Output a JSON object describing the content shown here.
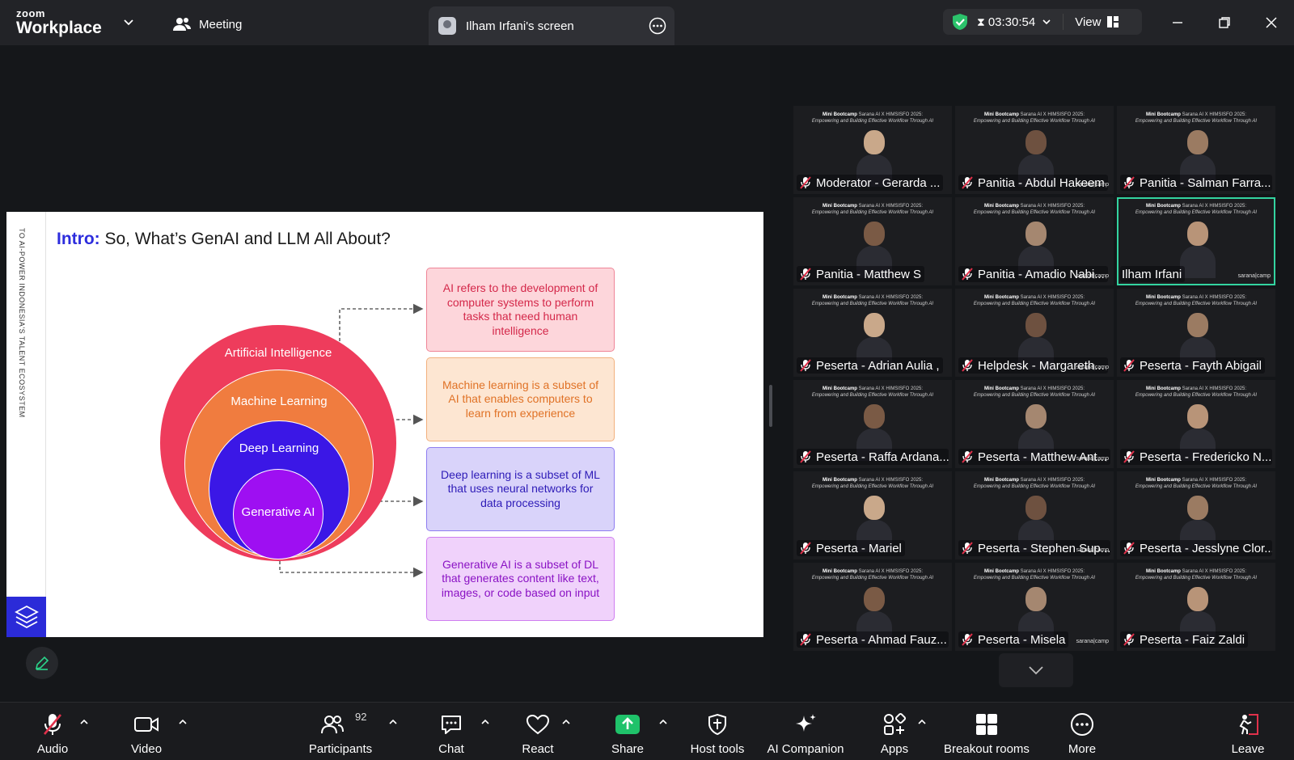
{
  "topbar": {
    "logo_zoom": "zoom",
    "logo_workplace": "Workplace",
    "meeting_label": "Meeting",
    "screen_tab_title": "Ilham Irfani's screen",
    "timer": "03:30:54",
    "view_label": "View"
  },
  "slide": {
    "side_text": "TO AI-POWER INDONESIA'S TALENT ECOSYSTEM",
    "title_prefix": "Intro:",
    "title_rest": "So, What’s GenAI and LLM All About?",
    "circles": {
      "ai": "Artificial Intelligence",
      "ml": "Machine Learning",
      "dl": "Deep Learning",
      "gen": "Generative AI"
    },
    "descriptions": {
      "ai": "AI refers to the development of computer systems to perform tasks that need human intelligence",
      "ml": "Machine learning is a subset of AI that enables computers to learn from experience",
      "dl": "Deep learning is a subset of ML that uses neural networks for data processing",
      "gen": "Generative AI is a subset of DL that generates content like text, images, or code based on input"
    },
    "colors": {
      "ai": "#ee3c5c",
      "ml": "#f07c3f",
      "dl": "#3b17e6",
      "gen": "#9e0ff2",
      "accent": "#2d2ddd"
    }
  },
  "gallery": {
    "tile_header_bold": "Mini Bootcamp",
    "tile_header_rest": "Sarana AI X HIMSISFO 2025:",
    "tile_header_sub": "Empowering and Building Effective Workflow Through AI",
    "watermark": "sarana|camp",
    "participants": [
      {
        "name": "Moderator - Gerarda ...",
        "muted": true
      },
      {
        "name": "Panitia - Abdul Hakeem",
        "muted": true
      },
      {
        "name": "Panitia - Salman Farra...",
        "muted": true
      },
      {
        "name": "Panitia - Matthew S",
        "muted": true
      },
      {
        "name": "Panitia - Amadio Nabi...",
        "muted": true
      },
      {
        "name": "Ilham Irfani",
        "muted": false,
        "active": true
      },
      {
        "name": "Peserta - Adrian Aulia ,",
        "muted": true
      },
      {
        "name": "Helpdesk - Margareth...",
        "muted": true
      },
      {
        "name": "Peserta - Fayth Abigail",
        "muted": true
      },
      {
        "name": "Peserta - Raffa Ardana...",
        "muted": true
      },
      {
        "name": "Peserta - Matthew Ant...",
        "muted": true
      },
      {
        "name": "Peserta - Fredericko N...",
        "muted": true
      },
      {
        "name": "Peserta - Mariel",
        "muted": true
      },
      {
        "name": "Peserta - Stephen Sup...",
        "muted": true
      },
      {
        "name": "Peserta - Jesslyne Clor...",
        "muted": true
      },
      {
        "name": "Peserta - Ahmad Fauz...",
        "muted": true
      },
      {
        "name": "Peserta - Misela",
        "muted": true
      },
      {
        "name": "Peserta - Faiz Zaldi",
        "muted": true
      }
    ]
  },
  "toolbar": {
    "audio": "Audio",
    "video": "Video",
    "participants": "Participants",
    "participant_count": "92",
    "chat": "Chat",
    "react": "React",
    "share": "Share",
    "host_tools": "Host tools",
    "ai_companion": "AI Companion",
    "apps": "Apps",
    "breakout_rooms": "Breakout rooms",
    "more": "More",
    "leave": "Leave"
  }
}
